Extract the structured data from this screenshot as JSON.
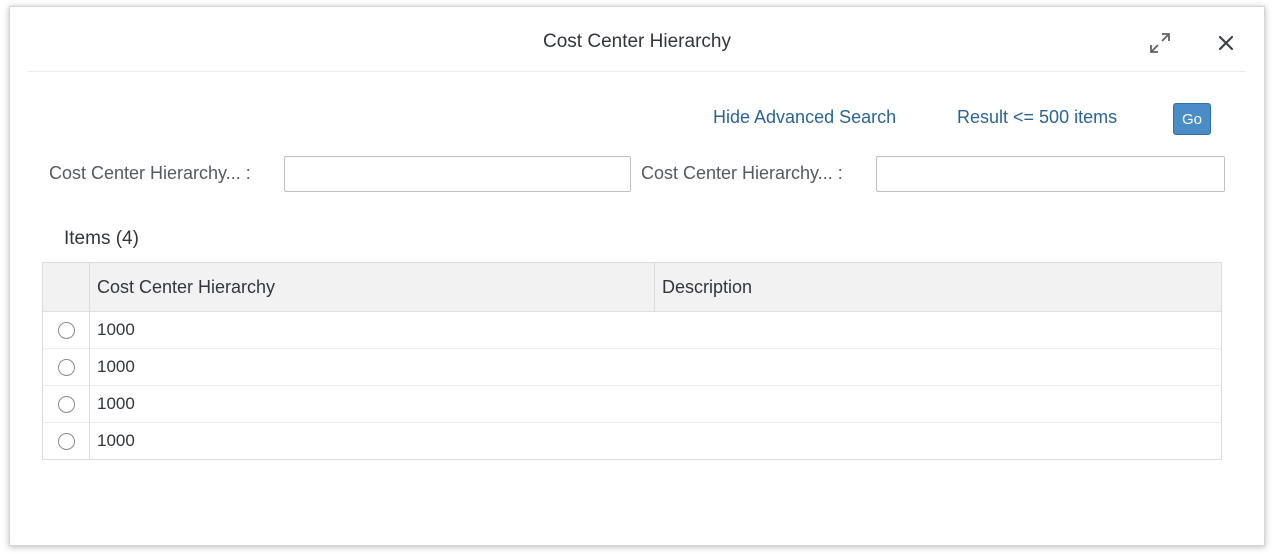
{
  "dialog": {
    "title": "Cost Center Hierarchy",
    "resize_icon": "resize-icon",
    "close_icon": "close-icon"
  },
  "toolbar": {
    "hide_advanced_search": "Hide Advanced Search",
    "result_limit": "Result <= 500 items",
    "go_label": "Go"
  },
  "filters": [
    {
      "label": "Cost Center Hierarchy... :",
      "value": "",
      "placeholder": ""
    },
    {
      "label": "Cost Center Hierarchy... :",
      "value": "",
      "placeholder": ""
    }
  ],
  "items": {
    "title": "Items (4)",
    "columns": [
      "Cost Center Hierarchy",
      "Description"
    ],
    "rows": [
      {
        "hierarchy": "1000",
        "description": ""
      },
      {
        "hierarchy": "1000",
        "description": ""
      },
      {
        "hierarchy": "1000",
        "description": ""
      },
      {
        "hierarchy": "1000",
        "description": ""
      }
    ]
  },
  "colors": {
    "accent": "#4a8cc5",
    "link": "#2a6496",
    "text": "#32363a"
  }
}
